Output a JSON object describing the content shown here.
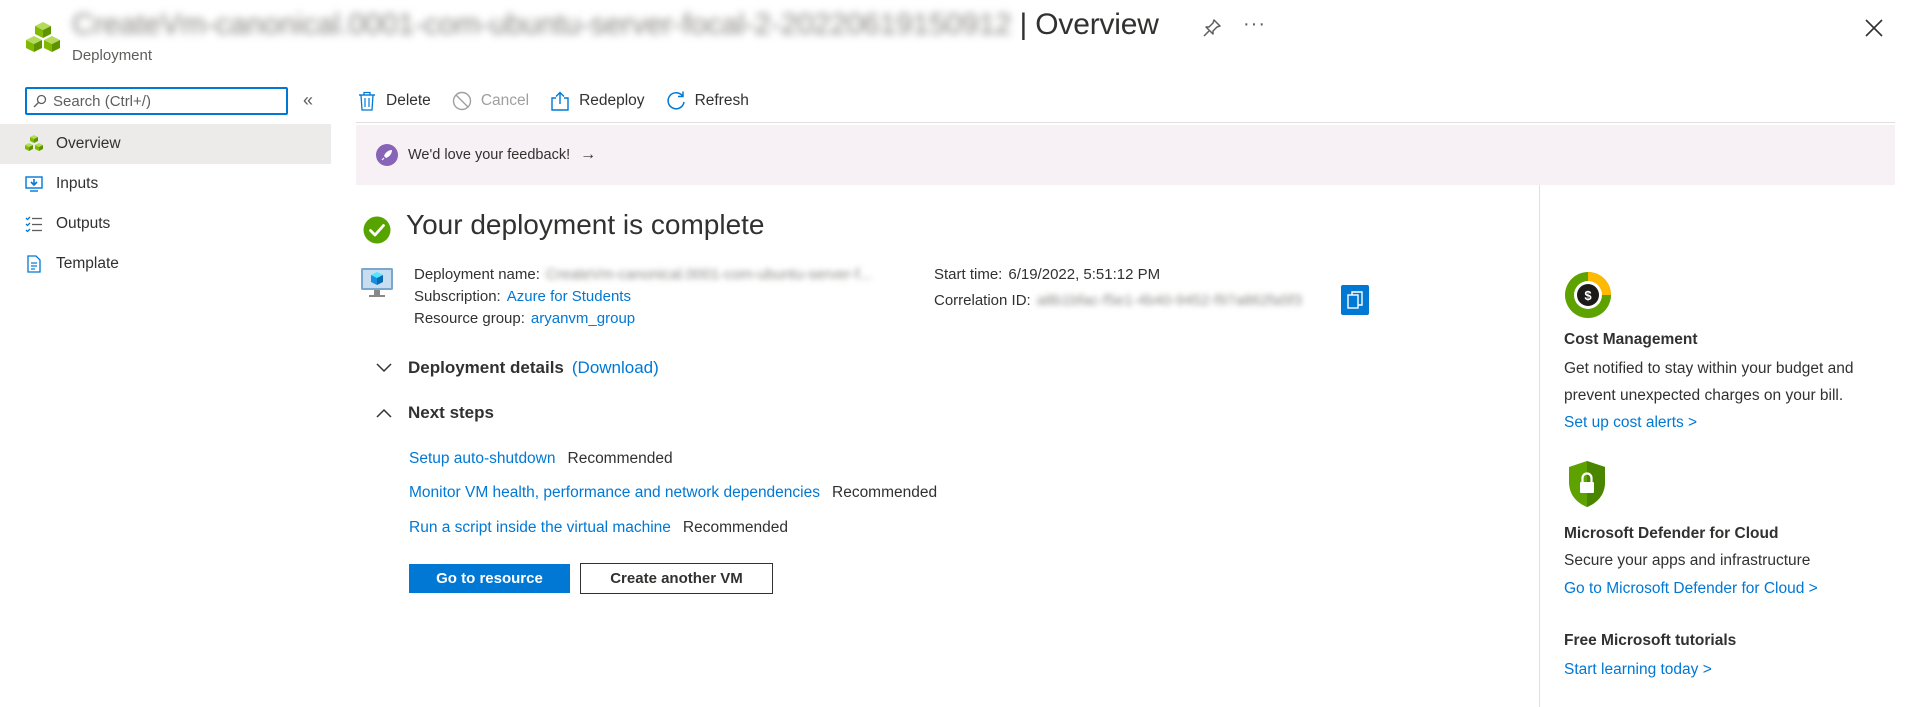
{
  "header": {
    "resource_name": "CreateVm-canonical.0001-com-ubuntu-server-focal-2-20220619150912",
    "title_suffix": " | Overview",
    "subtitle": "Deployment",
    "more_label": "···"
  },
  "sidebar": {
    "search_placeholder": "Search (Ctrl+/)",
    "collapse_label": "«",
    "items": [
      {
        "label": "Overview",
        "icon": "deployment-icon",
        "active": true
      },
      {
        "label": "Inputs",
        "icon": "inputs-icon",
        "active": false
      },
      {
        "label": "Outputs",
        "icon": "outputs-icon",
        "active": false
      },
      {
        "label": "Template",
        "icon": "template-icon",
        "active": false
      }
    ]
  },
  "toolbar": {
    "delete_label": "Delete",
    "cancel_label": "Cancel",
    "redeploy_label": "Redeploy",
    "refresh_label": "Refresh"
  },
  "banner": {
    "text": "We'd love your feedback!",
    "arrow": "→"
  },
  "deployment": {
    "title": "Your deployment is complete",
    "name_label": "Deployment name:",
    "name_value": "CreateVm-canonical.0001-com-ubuntu-server-f...",
    "subscription_label": "Subscription:",
    "subscription_value": "Azure for Students",
    "resource_group_label": "Resource group:",
    "resource_group_value": "aryanvm_group",
    "start_time_label": "Start time:",
    "start_time_value": "6/19/2022, 5:51:12 PM",
    "correlation_label": "Correlation ID:",
    "correlation_value": "a8b1bfac-f5e1-4b40-9452-f97a862fa5f3"
  },
  "sections": {
    "details_label": "Deployment details",
    "download_label": "(Download)",
    "next_steps_label": "Next steps"
  },
  "next_steps": [
    {
      "link": "Setup auto-shutdown",
      "tag": "Recommended"
    },
    {
      "link": "Monitor VM health, performance and network dependencies",
      "tag": "Recommended"
    },
    {
      "link": "Run a script inside the virtual machine",
      "tag": "Recommended"
    }
  ],
  "buttons": {
    "go_to_resource": "Go to resource",
    "create_another": "Create another VM"
  },
  "right_panel": {
    "cost": {
      "title": "Cost Management",
      "desc": "Get notified to stay within your budget and prevent unexpected charges on your bill.",
      "link": "Set up cost alerts >"
    },
    "defender": {
      "title": "Microsoft Defender for Cloud",
      "desc": "Secure your apps and infrastructure",
      "link": "Go to Microsoft Defender for Cloud >"
    },
    "tutorials": {
      "title": "Free Microsoft tutorials",
      "link": "Start learning today >"
    }
  },
  "colors": {
    "accent": "#0078d4",
    "success": "#57a300",
    "banner_bg": "#f7f0f5"
  }
}
